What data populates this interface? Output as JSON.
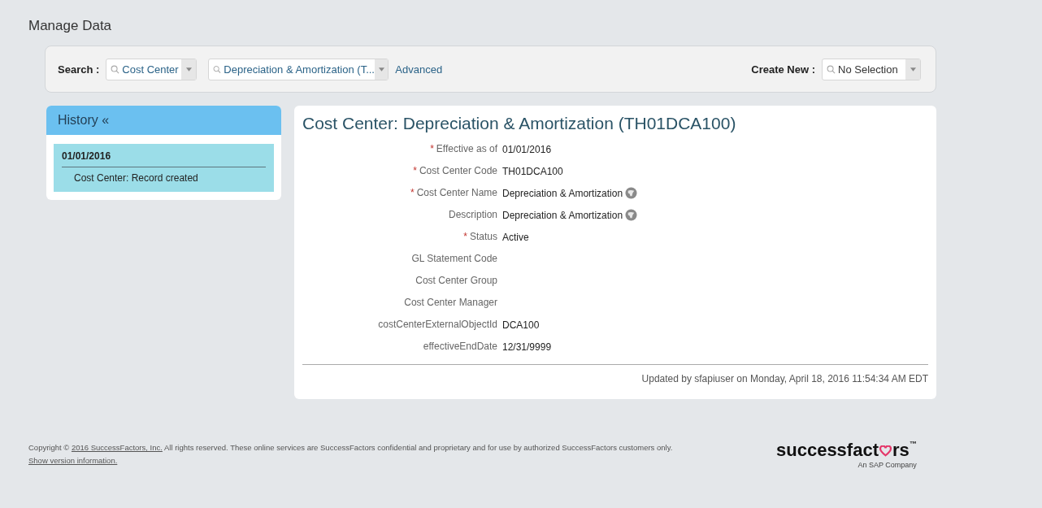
{
  "page_title": "Manage Data",
  "search": {
    "label": "Search :",
    "object_type": "Cost Center",
    "record": "Depreciation & Amortization (T...",
    "advanced_link": "Advanced"
  },
  "create_new": {
    "label": "Create New :",
    "value": "No Selection"
  },
  "history": {
    "title": "History «",
    "entries": [
      {
        "date": "01/01/2016",
        "text": "Cost Center: Record created",
        "selected": true
      }
    ]
  },
  "record": {
    "title": "Cost Center: Depreciation & Amortization (TH01DCA100)",
    "fields": [
      {
        "required_mark": "*",
        "label": "Effective as of",
        "value": "01/01/2016",
        "translatable": false
      },
      {
        "required_mark": "*",
        "label": "Cost Center Code",
        "value": "TH01DCA100",
        "translatable": false
      },
      {
        "required_mark": "*",
        "label": "Cost Center Name",
        "value": "Depreciation & Amortization",
        "translatable": true
      },
      {
        "label": "Description",
        "value": "Depreciation & Amortization",
        "translatable": true
      },
      {
        "required_mark": "*",
        "label": "Status",
        "value": "Active",
        "translatable": false
      },
      {
        "label": "GL Statement Code",
        "translatable": false
      },
      {
        "label": "Cost Center Group",
        "translatable": false
      },
      {
        "label": "Cost Center Manager",
        "translatable": false
      },
      {
        "label": "costCenterExternalObjectId",
        "value": "DCA100",
        "translatable": false
      },
      {
        "label": "effectiveEndDate",
        "value": "12/31/9999",
        "translatable": false
      }
    ],
    "updated": "Updated by sfapiuser on Monday, April 18, 2016 11:54:34 AM EDT"
  },
  "footer": {
    "before": "Copyright © ",
    "link1": "2016 SuccessFactors, Inc.",
    "middle": " All rights reserved. These online services are SuccessFactors confidential and proprietary and for use by authorized SuccessFactors customers only. ",
    "link2": "Show version information."
  },
  "logo": {
    "before": "successfact",
    "after": "rs",
    "mark": "™",
    "tagline": "An SAP Company"
  }
}
